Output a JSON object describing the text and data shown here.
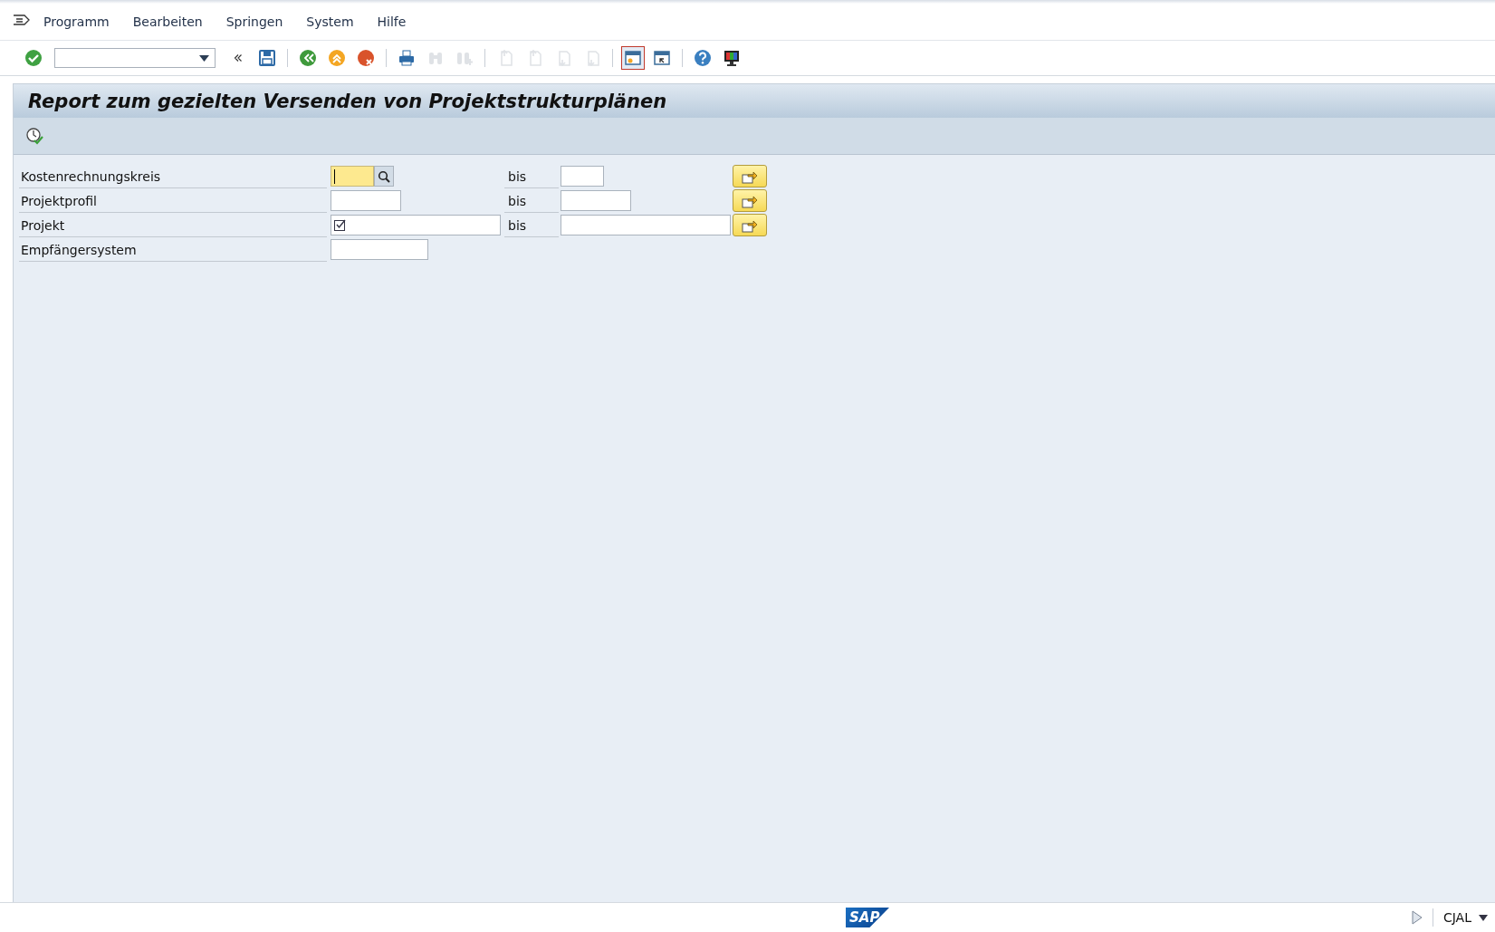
{
  "menu": [
    "Programm",
    "Bearbeiten",
    "Springen",
    "System",
    "Hilfe"
  ],
  "toolbar": [
    {
      "kind": "enter",
      "disabled": false
    },
    {
      "kind": "command",
      "disabled": false
    },
    {
      "kind": "collapse",
      "disabled": false
    },
    {
      "kind": "save",
      "disabled": false
    },
    {
      "kind": "sep"
    },
    {
      "kind": "back",
      "disabled": false
    },
    {
      "kind": "exit",
      "disabled": false
    },
    {
      "kind": "cancel",
      "disabled": false
    },
    {
      "kind": "sep"
    },
    {
      "kind": "print",
      "disabled": false
    },
    {
      "kind": "find",
      "disabled": true
    },
    {
      "kind": "findnext",
      "disabled": true
    },
    {
      "kind": "sep"
    },
    {
      "kind": "first",
      "disabled": true
    },
    {
      "kind": "prev",
      "disabled": true
    },
    {
      "kind": "next",
      "disabled": true
    },
    {
      "kind": "last",
      "disabled": true
    },
    {
      "kind": "sep"
    },
    {
      "kind": "session",
      "disabled": false,
      "selected": true
    },
    {
      "kind": "shortcut",
      "disabled": false,
      "selected": false
    },
    {
      "kind": "sep"
    },
    {
      "kind": "help",
      "disabled": false
    },
    {
      "kind": "layout",
      "disabled": false
    }
  ],
  "title": "Report zum gezielten Versenden von Projektstrukturplänen",
  "rows": [
    {
      "label": "Kostenrechnungskreis",
      "focused": true,
      "search_help": true,
      "marked": false,
      "range_label": "bis"
    },
    {
      "label": "Projektprofil",
      "focused": false,
      "search_help": false,
      "marked": false,
      "range_label": "bis"
    },
    {
      "label": "Projekt",
      "focused": false,
      "search_help": false,
      "marked": true,
      "range_label": "bis"
    },
    {
      "label": "Empfängersystem",
      "focused": false,
      "search_help": false,
      "marked": false
    }
  ],
  "status": {
    "logo": "SAP",
    "transaction": "CJAL"
  }
}
